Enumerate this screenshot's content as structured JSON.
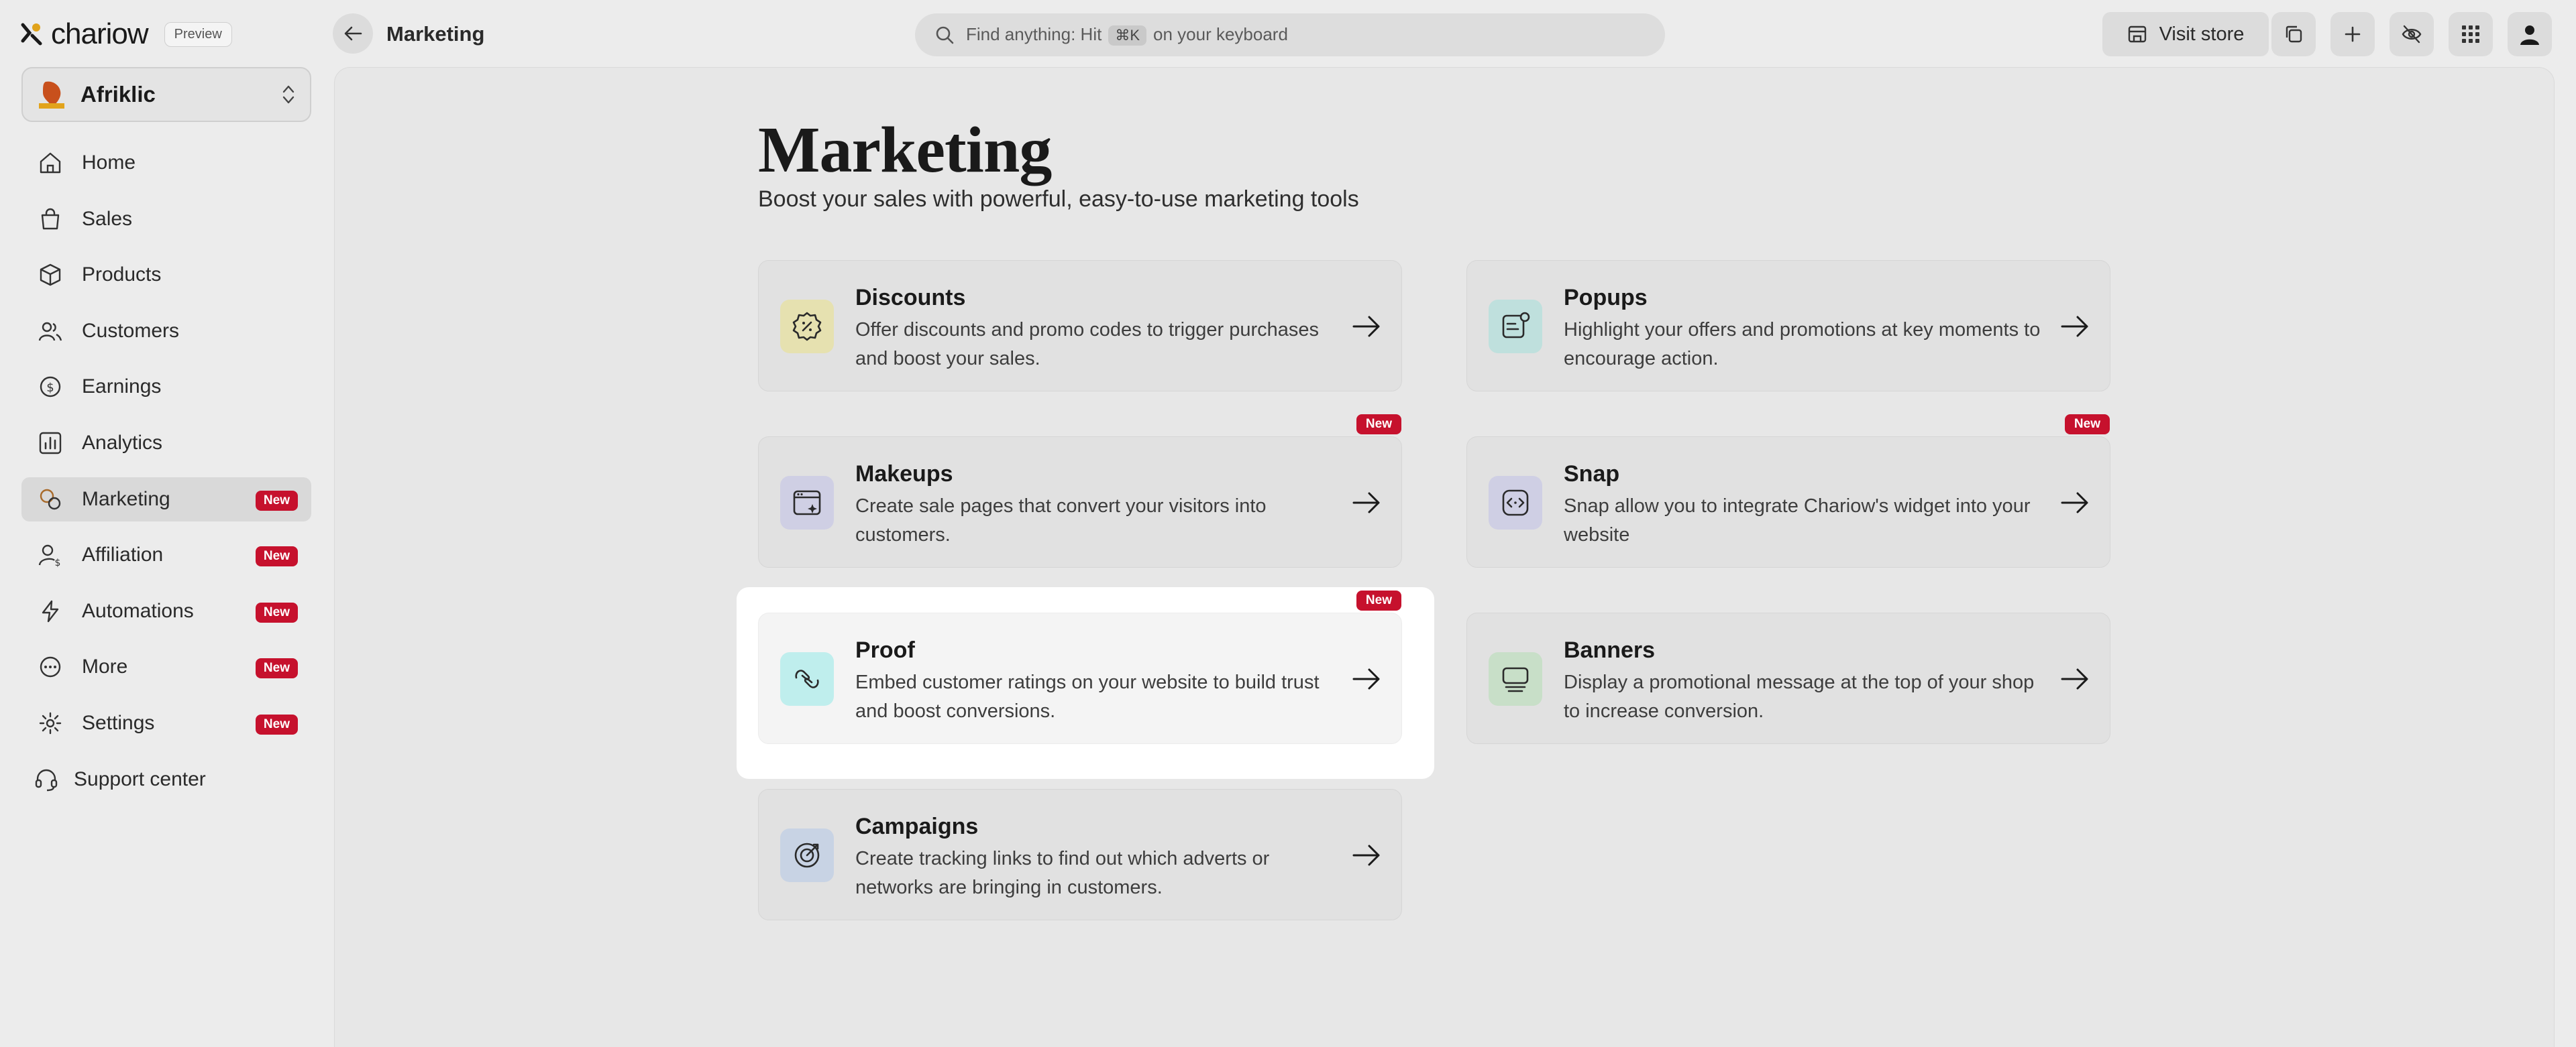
{
  "app": {
    "logo_text": "chariow",
    "preview_label": "Preview",
    "page_crumb": "Marketing"
  },
  "search": {
    "prefix": "Find anything: Hit",
    "shortcut": "⌘K",
    "suffix": "on your keyboard"
  },
  "topbar": {
    "visit_store_label": "Visit store",
    "icons": [
      "copy-icon",
      "plus-icon",
      "eye-off-icon",
      "grid-apps-icon",
      "user-avatar-icon"
    ]
  },
  "store": {
    "name": "Afriklic"
  },
  "nav": {
    "items": [
      {
        "label": "Home",
        "icon": "home-icon",
        "badge": ""
      },
      {
        "label": "Sales",
        "icon": "shopping-bag-icon",
        "badge": ""
      },
      {
        "label": "Products",
        "icon": "box-icon",
        "badge": ""
      },
      {
        "label": "Customers",
        "icon": "users-icon",
        "badge": ""
      },
      {
        "label": "Earnings",
        "icon": "coins-icon",
        "badge": ""
      },
      {
        "label": "Analytics",
        "icon": "bar-chart-icon",
        "badge": ""
      },
      {
        "label": "Marketing",
        "icon": "megaphone-icon",
        "badge": "New",
        "active": true
      },
      {
        "label": "Affiliation",
        "icon": "user-dollar-icon",
        "badge": "New"
      },
      {
        "label": "Automations",
        "icon": "bolt-icon",
        "badge": "New"
      },
      {
        "label": "More",
        "icon": "circle-dots-icon",
        "badge": "New"
      },
      {
        "label": "Settings",
        "icon": "gear-icon",
        "badge": "New"
      }
    ],
    "support_label": "Support center"
  },
  "main": {
    "title": "Marketing",
    "subtitle": "Boost your sales with powerful, easy-to-use marketing tools",
    "cards": [
      {
        "title": "Discounts",
        "desc": "Offer discounts and promo codes to trigger purchases and boost your sales.",
        "badge": "",
        "icon": "badge-percent-icon",
        "color": "#e6e1b0"
      },
      {
        "title": "Popups",
        "desc": "Highlight your offers and promotions at key moments to encourage action.",
        "badge": "",
        "icon": "popup-message-icon",
        "color": "#bfe0dd"
      },
      {
        "title": "Makeups",
        "desc": "Create sale pages that convert your visitors into customers.",
        "badge": "New",
        "icon": "browser-sparkle-icon",
        "color": "#cfcfe4"
      },
      {
        "title": "Snap",
        "desc": "Snap allow you to integrate Chariow's widget into your website",
        "badge": "New",
        "icon": "code-widget-icon",
        "color": "#cfcfe4"
      },
      {
        "title": "Proof",
        "desc": "Embed customer ratings on your website to build trust and boost conversions.",
        "badge": "New",
        "icon": "handshake-icon",
        "color": "#bfeeed"
      },
      {
        "title": "Banners",
        "desc": "Display a promotional message at the top of your shop to increase conversion.",
        "badge": "",
        "icon": "banner-icon",
        "color": "#c8dfc8"
      },
      {
        "title": "Campaigns",
        "desc": "Create tracking links to find out which adverts or networks are bringing in customers.",
        "badge": "",
        "icon": "target-icon",
        "color": "#c8d3e4"
      }
    ]
  },
  "colors": {
    "badge_red": "#c6112d",
    "background": "#ececec",
    "panel": "#e7e7e7",
    "card": "#e1e1e1"
  }
}
